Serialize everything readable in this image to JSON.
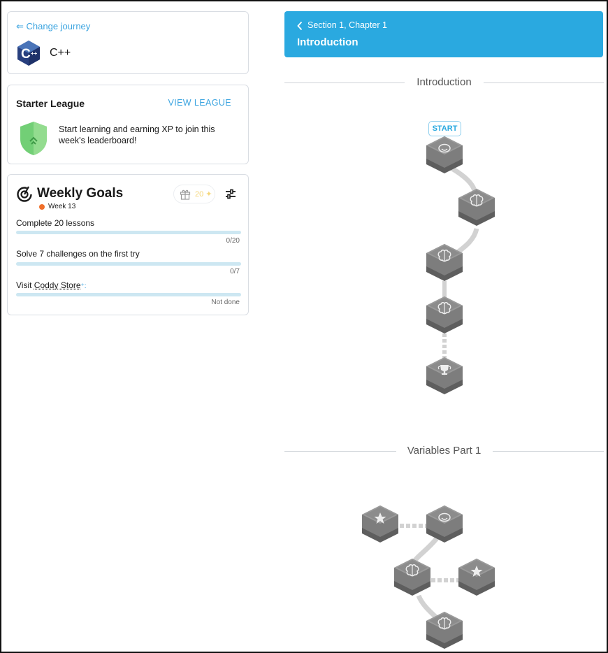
{
  "journey": {
    "change_link": "⇐ Change journey",
    "language": "C++"
  },
  "league": {
    "title": "Starter League",
    "view_label": "VIEW LEAGUE",
    "message": "Start learning and earning XP to join this week's leaderboard!"
  },
  "weekly_goals": {
    "title": "Weekly Goals",
    "week": "Week 13",
    "reward": "20 ✦",
    "goals": [
      {
        "label": "Complete 20 lessons",
        "status": "0/20",
        "progress": 0
      },
      {
        "label": "Solve 7 challenges on the first try",
        "status": "0/7",
        "progress": 0
      },
      {
        "label_prefix": "Visit ",
        "link": "Coddy Store",
        "suffix": "⁺:",
        "status": "Not done",
        "progress": 0
      }
    ]
  },
  "chapter": {
    "breadcrumb": "Section 1, Chapter 1",
    "title": "Introduction"
  },
  "sections": [
    {
      "title": "Introduction"
    },
    {
      "title": "Variables Part 1"
    }
  ],
  "path": {
    "start_label": "START",
    "nodes_intro": [
      "lesson-mascot",
      "lesson-brain",
      "lesson-brain",
      "lesson-brain",
      "trophy"
    ],
    "nodes_vars": [
      "star",
      "lesson-mascot",
      "lesson-brain",
      "star",
      "lesson-brain"
    ]
  },
  "colors": {
    "accent": "#2aa9e0",
    "link": "#3ba4e0",
    "node_gray": "#8a8a8a",
    "progress_track": "#cde7f2",
    "week_dot": "#f06f2a"
  }
}
